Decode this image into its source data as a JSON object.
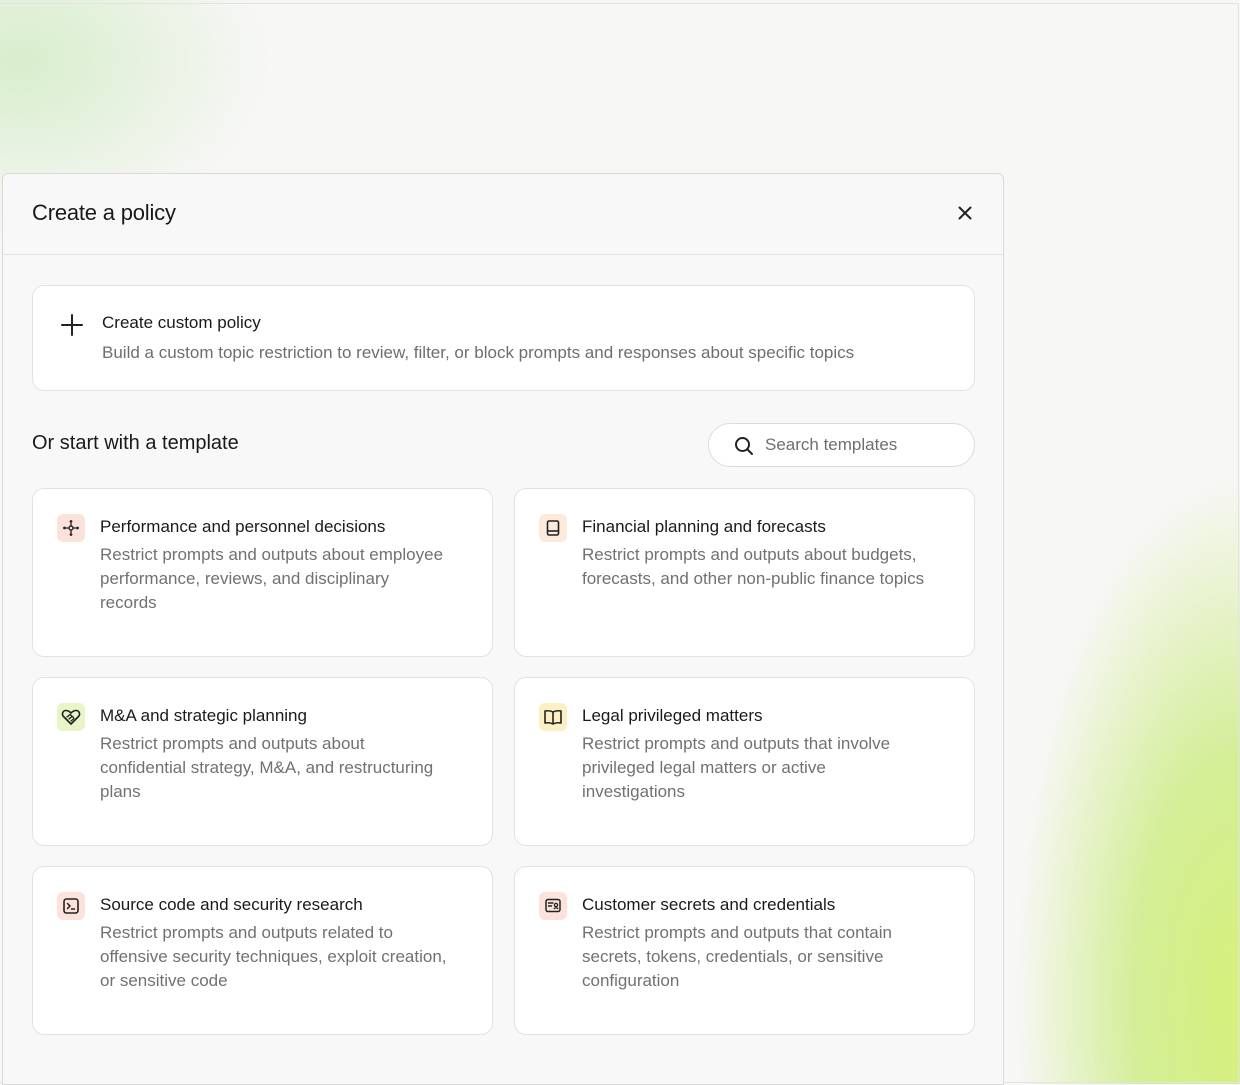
{
  "modal": {
    "title": "Create a policy"
  },
  "custom_policy": {
    "title": "Create custom policy",
    "description": "Build a custom topic restriction to review, filter, or block prompts and responses about specific topics"
  },
  "templates_section": {
    "title": "Or start with a template",
    "search_placeholder": "Search templates"
  },
  "templates": [
    {
      "title": "Performance and personnel decisions",
      "description": "Restrict prompts and outputs about employee performance, reviews, and disciplinary records",
      "icon": "personnel-network-icon",
      "icon_bg": "#fbe3dc"
    },
    {
      "title": "Financial planning and forecasts",
      "description": "Restrict prompts and outputs about budgets, forecasts, and other non-public finance topics",
      "icon": "ledger-book-icon",
      "icon_bg": "#fcebdc"
    },
    {
      "title": "M&A and strategic planning",
      "description": "Restrict prompts and outputs about confidential strategy, M&A, and restructuring plans",
      "icon": "handshake-heart-icon",
      "icon_bg": "#e8f5c6"
    },
    {
      "title": "Legal privileged matters",
      "description": "Restrict prompts and outputs that involve privileged legal matters or active investigations",
      "icon": "open-book-icon",
      "icon_bg": "#fbf0c3"
    },
    {
      "title": "Source code and security research",
      "description": "Restrict prompts and outputs related to offensive security techniques, exploit creation, or sensitive code",
      "icon": "terminal-icon",
      "icon_bg": "#fbe3dc"
    },
    {
      "title": "Customer secrets and credentials",
      "description": "Restrict prompts and outputs that contain secrets, tokens, credentials, or sensitive configuration",
      "icon": "id-card-icon",
      "icon_bg": "#fbe3dc"
    }
  ]
}
